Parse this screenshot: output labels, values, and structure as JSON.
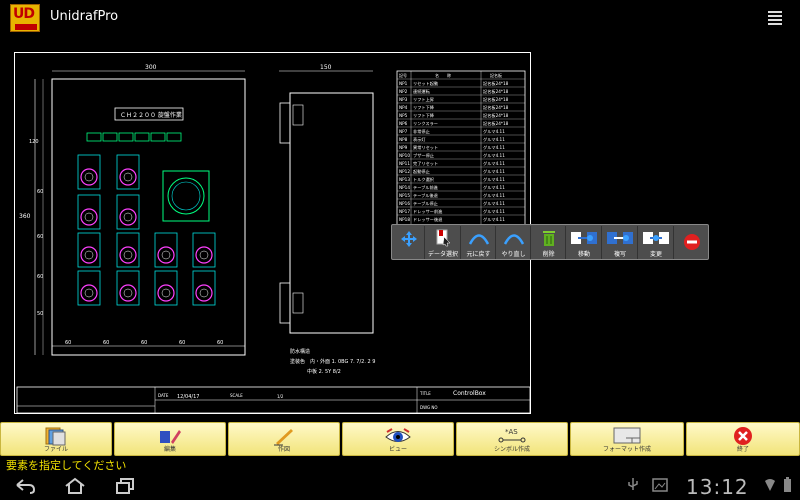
{
  "app": {
    "title": "UnidrafPro",
    "logo_text": "UD"
  },
  "drawing": {
    "panel_title": "ＣＨ２２００ 旋盤作業",
    "dim_top_width": "300",
    "dim_side_width": "150",
    "dim_height": "360",
    "dim_120": "120",
    "dim_bottom": [
      "60",
      "60",
      "60",
      "60",
      "60"
    ],
    "dim_left": [
      "60",
      "60",
      "60",
      "50",
      "60"
    ],
    "notes": [
      "防水構造",
      "塗装色　内・外面 1. 0BG 7. 7/2. 2 9",
      "中板 2. 5Y  8/2"
    ],
    "table_headers": [
      "記号",
      "名　　称",
      "記名板"
    ],
    "table_rows": [
      [
        "NP1",
        "リセット起動",
        "記名板24*18"
      ],
      [
        "NP2",
        "連続運転",
        "記名板24*18"
      ],
      [
        "NP3",
        "リフト上昇",
        "記名板24*18"
      ],
      [
        "NP4",
        "リフト下降",
        "記名板24*18"
      ],
      [
        "NP5",
        "リフト下降",
        "記名板24*18"
      ],
      [
        "NP6",
        "リンクスラー",
        "記名板24*18"
      ],
      [
        "NP7",
        "非常停止",
        "グルマ4.11"
      ],
      [
        "NP8",
        "表示灯",
        "グルマ4.11"
      ],
      [
        "NP9",
        "異常リセット",
        "グルマ4.11"
      ],
      [
        "NP10",
        "ブザー停止",
        "グルマ4.11"
      ],
      [
        "NP11",
        "完了リセット",
        "グルマ4.11"
      ],
      [
        "NP12",
        "起動停止",
        "グルマ4.11"
      ],
      [
        "NP13",
        "トルク選択",
        "グルマ4.11"
      ],
      [
        "NP14",
        "テーブル前進",
        "グルマ4.11"
      ],
      [
        "NP15",
        "テーブル後退",
        "グルマ4.11"
      ],
      [
        "NP16",
        "テーブル停止",
        "グルマ4.11"
      ],
      [
        "NP17",
        "ドレッサー前進",
        "グルマ4.11"
      ],
      [
        "NP18",
        "ドレッサー後退",
        "グルマ4.11"
      ]
    ],
    "titleblock": {
      "date_label": "DATE",
      "date": "12/04/17",
      "scale_label": "SCALE",
      "scale": "1/2",
      "title_label": "TITLE",
      "title": "ControlBox",
      "dwg_label": "DWG NO"
    }
  },
  "edit_toolbar": [
    {
      "name": "move-handle",
      "label": ""
    },
    {
      "name": "data-select",
      "label": "データ選択"
    },
    {
      "name": "undo",
      "label": "元に戻す"
    },
    {
      "name": "redo",
      "label": "やり直し"
    },
    {
      "name": "delete",
      "label": "削除"
    },
    {
      "name": "move",
      "label": "移動"
    },
    {
      "name": "copy",
      "label": "複写"
    },
    {
      "name": "change",
      "label": "変更"
    },
    {
      "name": "close",
      "label": ""
    }
  ],
  "bottom_toolbar": [
    {
      "name": "file",
      "label": "ファイル"
    },
    {
      "name": "edit",
      "label": "編集"
    },
    {
      "name": "draw",
      "label": "作図"
    },
    {
      "name": "view",
      "label": "ビュー"
    },
    {
      "name": "symbol",
      "label": "シンボル作成",
      "icon_text": "*AS"
    },
    {
      "name": "format",
      "label": "フォーマット作成"
    },
    {
      "name": "exit",
      "label": "終了"
    }
  ],
  "status": {
    "message": "要素を指定してください"
  },
  "system": {
    "clock": "13:12"
  },
  "colors": {
    "accent": "#f0e000",
    "toolbar": "#f2e47a",
    "cad_green": "#00ff80",
    "cad_magenta": "#ff40ff",
    "cad_cyan": "#00e0e0"
  }
}
